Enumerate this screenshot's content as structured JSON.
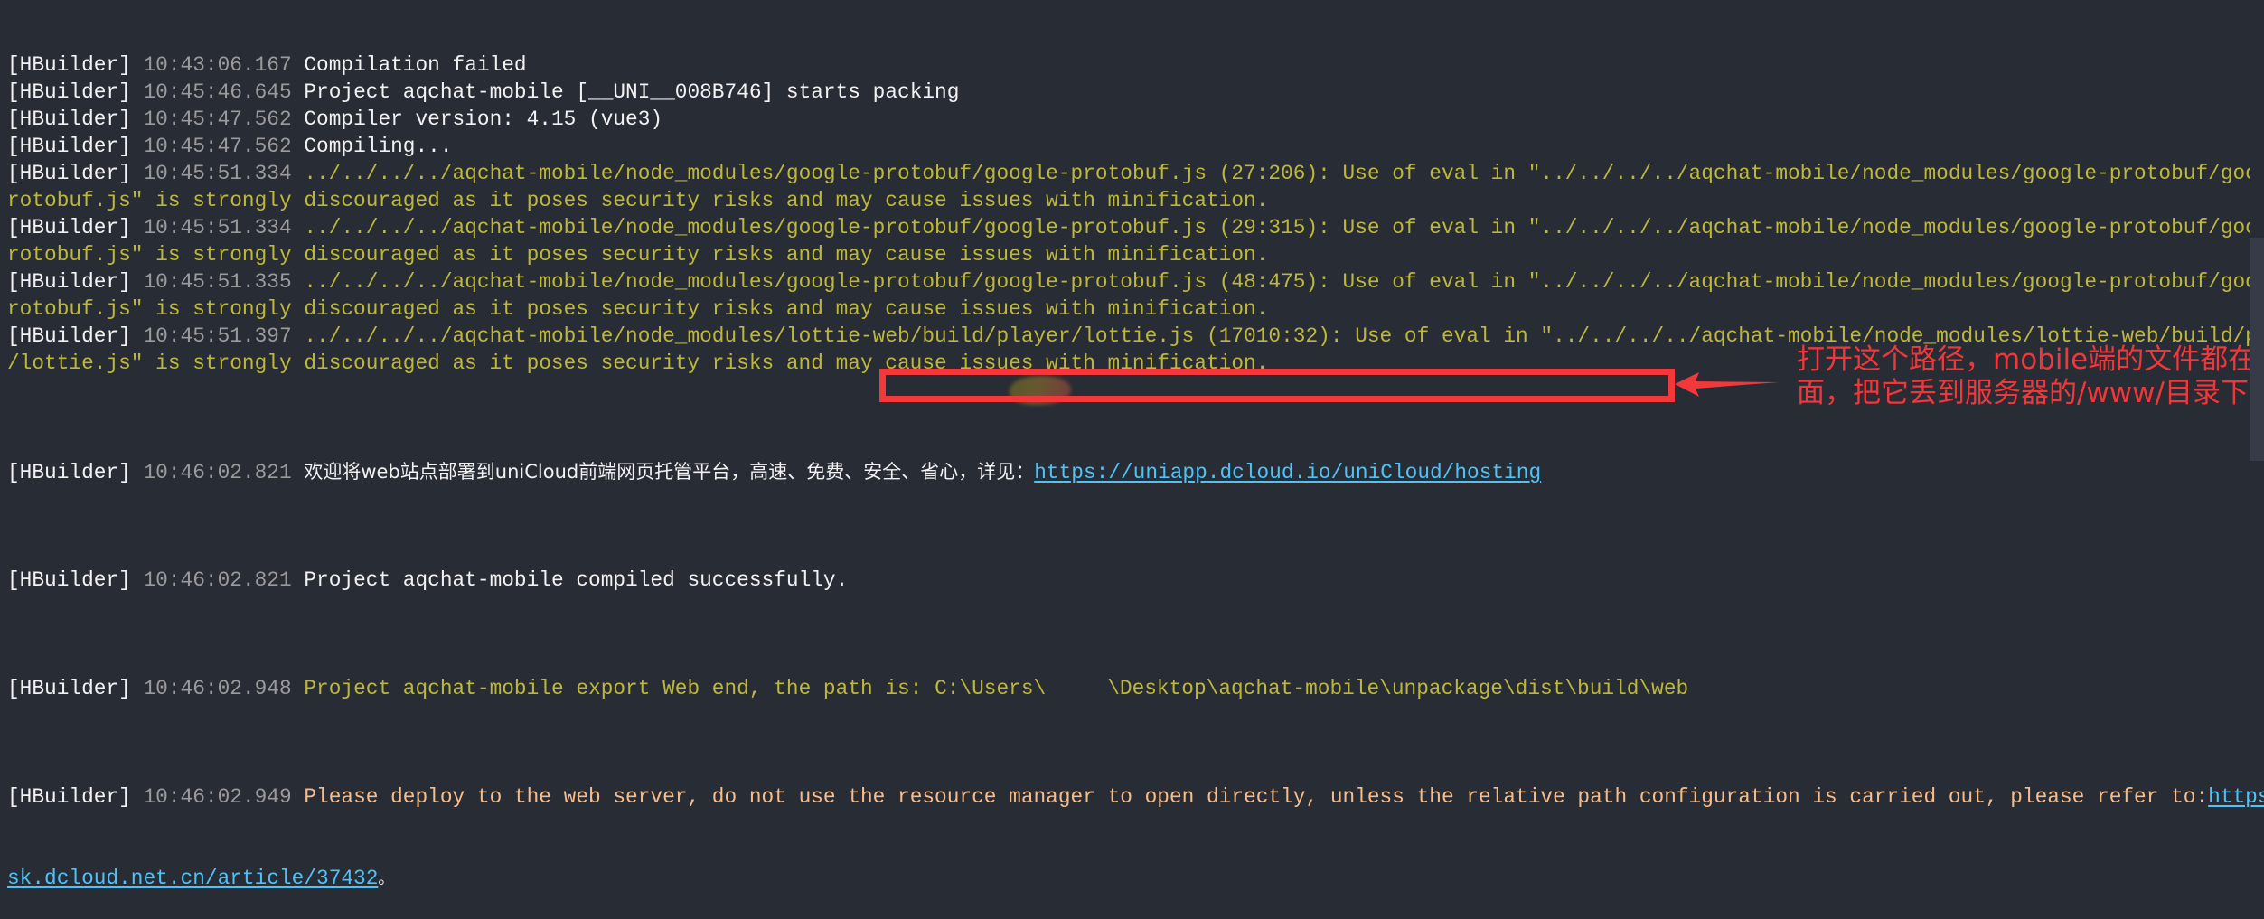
{
  "console": {
    "lines": [
      {
        "tag": "[HBuilder]",
        "time": "10:43:06.167",
        "text": "Compilation failed",
        "color": "white"
      },
      {
        "tag": "[HBuilder]",
        "time": "10:45:46.645",
        "text": "Project aqchat-mobile [__UNI__008B746] starts packing",
        "color": "white"
      },
      {
        "tag": "[HBuilder]",
        "time": "10:45:47.562",
        "text": "Compiler version: 4.15 (vue3)",
        "color": "white"
      },
      {
        "tag": "[HBuilder]",
        "time": "10:45:47.562",
        "text": "Compiling...",
        "color": "white"
      },
      {
        "tag": "[HBuilder]",
        "time": "10:45:51.334",
        "text": "../../../../aqchat-mobile/node_modules/google-protobuf/google-protobuf.js (27:206): Use of eval in \"../../../../aqchat-mobile/node_modules/google-protobuf/google-p",
        "color": "yellow"
      },
      {
        "tag": "",
        "time": "",
        "text": "rotobuf.js\" is strongly discouraged as it poses security risks and may cause issues with minification.",
        "color": "yellow"
      },
      {
        "tag": "[HBuilder]",
        "time": "10:45:51.334",
        "text": "../../../../aqchat-mobile/node_modules/google-protobuf/google-protobuf.js (29:315): Use of eval in \"../../../../aqchat-mobile/node_modules/google-protobuf/google-p",
        "color": "yellow"
      },
      {
        "tag": "",
        "time": "",
        "text": "rotobuf.js\" is strongly discouraged as it poses security risks and may cause issues with minification.",
        "color": "yellow"
      },
      {
        "tag": "[HBuilder]",
        "time": "10:45:51.335",
        "text": "../../../../aqchat-mobile/node_modules/google-protobuf/google-protobuf.js (48:475): Use of eval in \"../../../../aqchat-mobile/node_modules/google-protobuf/google-p",
        "color": "yellow"
      },
      {
        "tag": "",
        "time": "",
        "text": "rotobuf.js\" is strongly discouraged as it poses security risks and may cause issues with minification.",
        "color": "yellow"
      },
      {
        "tag": "[HBuilder]",
        "time": "10:45:51.397",
        "text": "../../../../aqchat-mobile/node_modules/lottie-web/build/player/lottie.js (17010:32): Use of eval in \"../../../../aqchat-mobile/node_modules/lottie-web/build/player",
        "color": "yellow"
      },
      {
        "tag": "",
        "time": "",
        "text": "/lottie.js\" is strongly discouraged as it poses security risks and may cause issues with minification.",
        "color": "yellow"
      }
    ],
    "hosting_line": {
      "tag": "[HBuilder]",
      "time": "10:46:02.821",
      "text": "欢迎将web站点部署到uniCloud前端网页托管平台，高速、免费、安全、省心，详见：",
      "link": "https://uniapp.dcloud.io/uniCloud/hosting"
    },
    "success_line": {
      "tag": "[HBuilder]",
      "time": "10:46:02.821",
      "text": "Project aqchat-mobile compiled successfully."
    },
    "export_line": {
      "tag": "[HBuilder]",
      "time": "10:46:02.948",
      "text": "Project aqchat-mobile export Web end, the path is:",
      "path_prefix": " C:\\Users\\",
      "path_masked": "█████",
      "path_suffix": "\\Desktop\\aqchat-mobile\\unpackage\\dist\\build\\web"
    },
    "deploy_line": {
      "tag": "[HBuilder]",
      "time": "10:46:02.949",
      "text": "Please deploy to the web server, do not use the resource manager to open directly, unless the relative path configuration is carried out, please refer to:",
      "link_part1": "https://a",
      "link_part2": "sk.dcloud.net.cn/article/37432",
      "trailing": "。"
    }
  },
  "annotation": {
    "line1": "打开这个路径，mobile端的文件都在里",
    "line2": "面，把它丢到服务器的/www/目录下",
    "color": "#f0383a"
  },
  "colors": {
    "background": "#282c35",
    "white": "#f2f2f2",
    "timestamp": "#9b9b9b",
    "yellow": "#bdb83b",
    "orange": "#f5bc8c",
    "link": "#4fc3f7",
    "highlight": "#f2383a"
  }
}
